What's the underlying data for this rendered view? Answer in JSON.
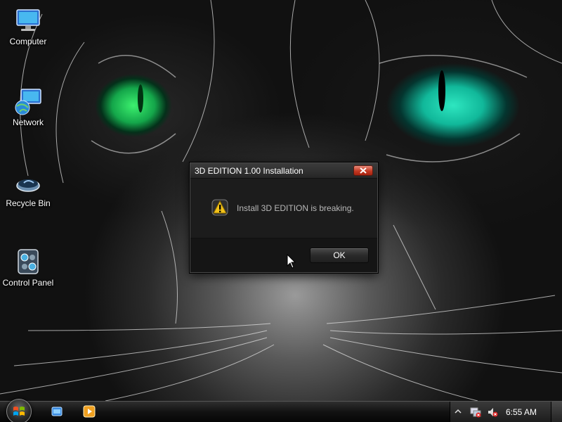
{
  "desktop": {
    "icons": [
      {
        "label": "Computer",
        "icon": "computer-icon"
      },
      {
        "label": "Network",
        "icon": "network-icon"
      },
      {
        "label": "Recycle Bin",
        "icon": "recycle-bin-icon"
      },
      {
        "label": "Control Panel",
        "icon": "control-panel-icon"
      }
    ]
  },
  "dialog": {
    "title": "3D EDITION 1.00 Installation",
    "message": "Install 3D EDITION is breaking.",
    "ok_label": "OK",
    "icon": "warning-icon"
  },
  "taskbar": {
    "start_icon": "windows-start-orb-icon",
    "quick_launch": [
      "explorer-icon",
      "media-player-icon"
    ],
    "tray_icons": [
      "show-hidden-icons-arrow",
      "network-status-icon",
      "volume-muted-icon"
    ],
    "clock": "6:55 AM"
  },
  "colors": {
    "close_button": "#c43a24",
    "dialog_bg": "#1a1a1a",
    "message_text": "#b8b8b8"
  }
}
